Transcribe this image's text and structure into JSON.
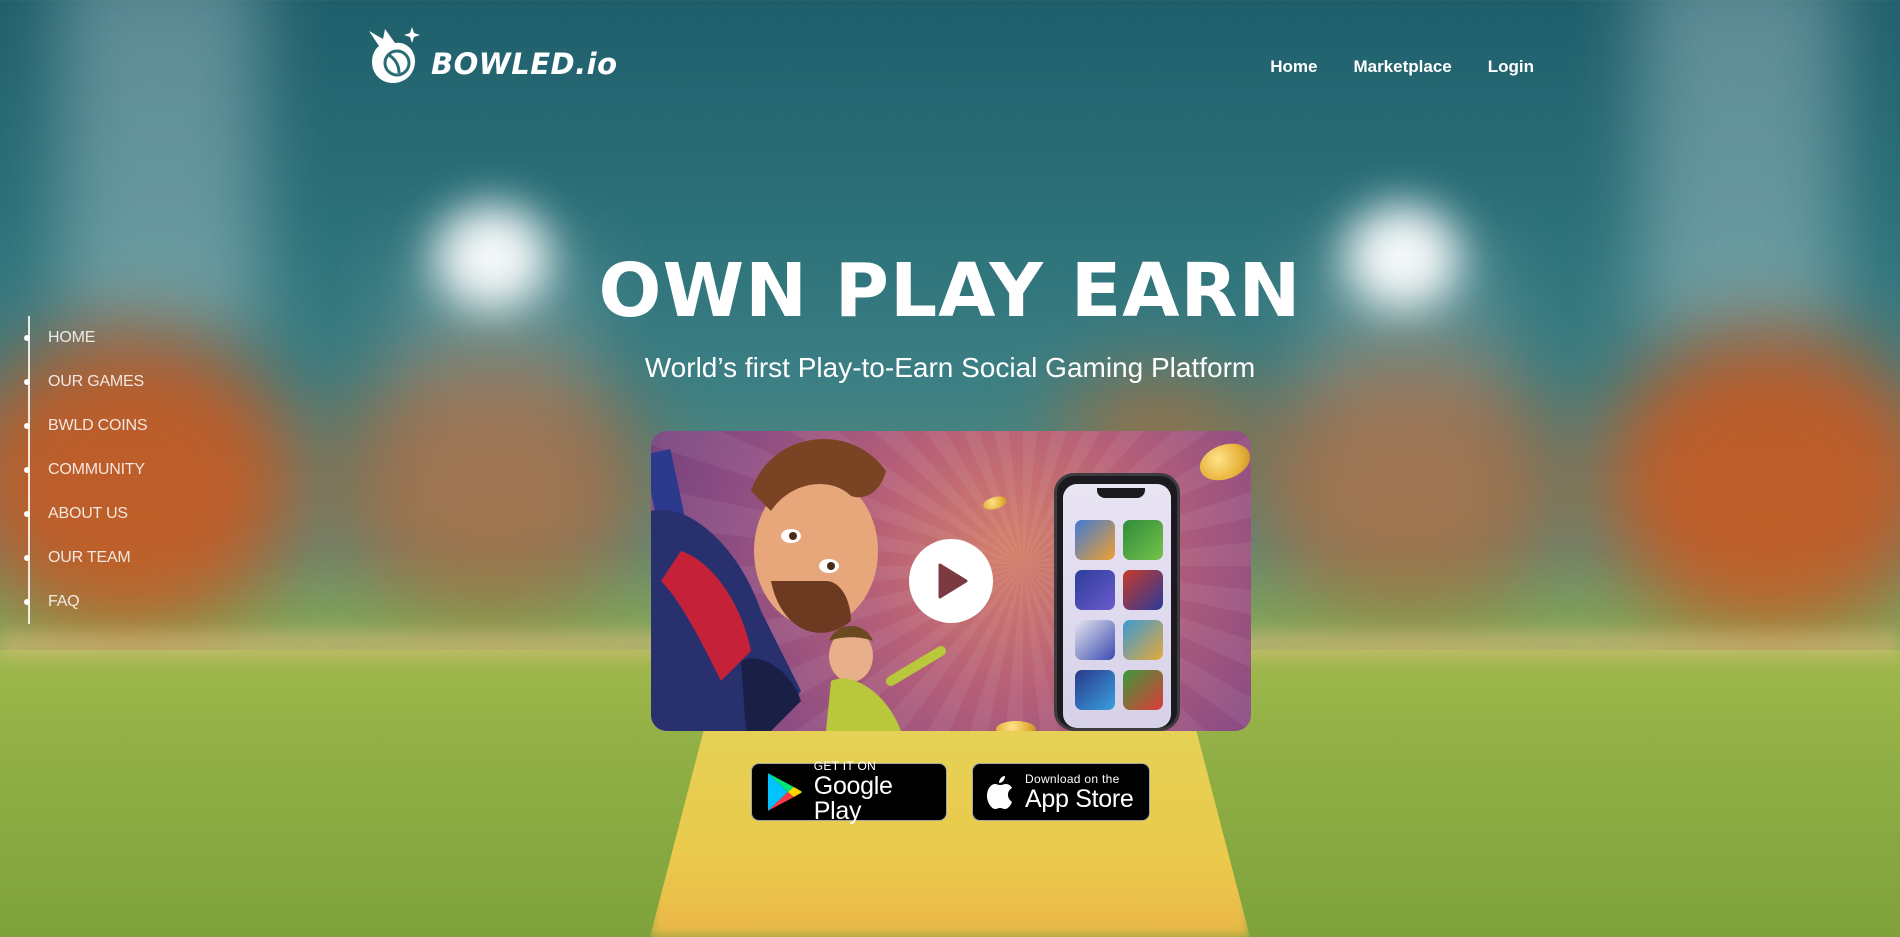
{
  "brand": {
    "name": "BOWLED.io"
  },
  "topnav": {
    "items": [
      "Home",
      "Marketplace",
      "Login"
    ]
  },
  "sidenav": {
    "items": [
      "HOME",
      "OUR GAMES",
      "BWLD COINS",
      "COMMUNITY",
      "ABOUT US",
      "OUR TEAM",
      "FAQ"
    ]
  },
  "hero": {
    "title": "OWN PLAY EARN",
    "subtitle": "World’s first Play-to-Earn Social Gaming Platform"
  },
  "stores": {
    "google": {
      "small": "GET IT ON",
      "big": "Google Play"
    },
    "apple": {
      "small": "Download on the",
      "big": "App Store"
    }
  },
  "colors": {
    "pitch": "#e8d35a",
    "sky": "#1f5f6c",
    "flare": "#d0571c"
  }
}
